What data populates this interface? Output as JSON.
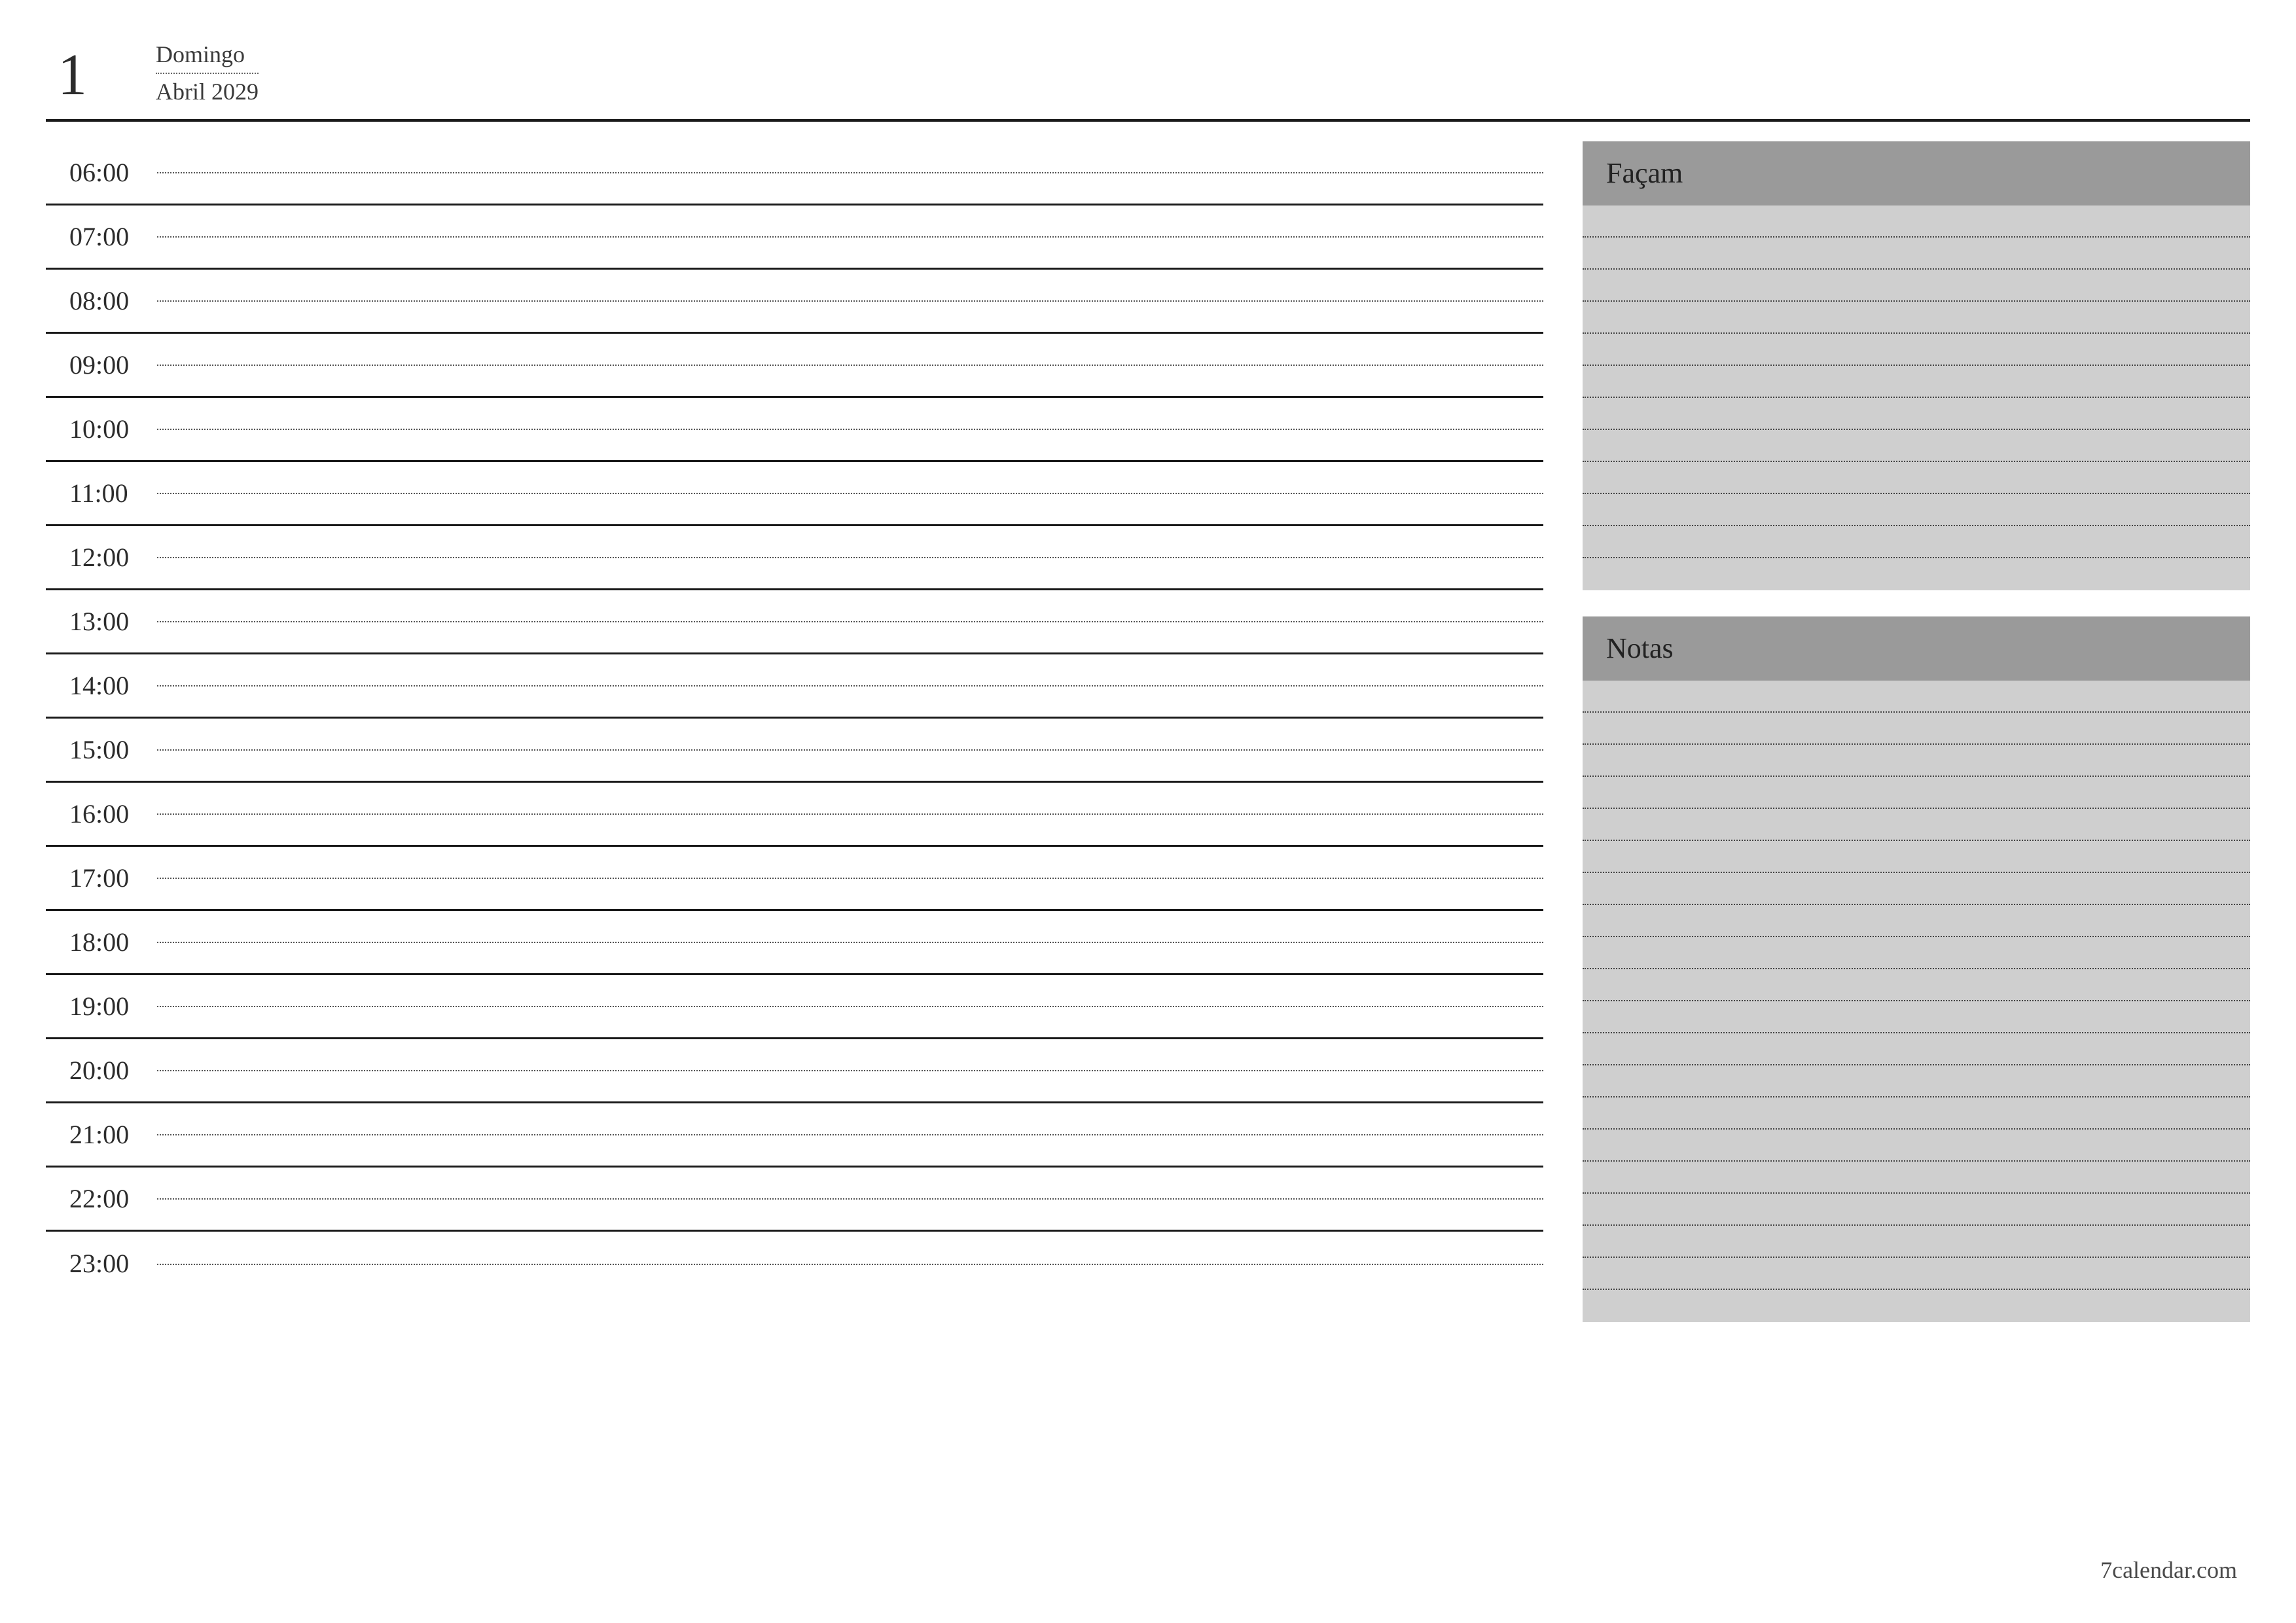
{
  "header": {
    "day_number": "1",
    "day_of_week": "Domingo",
    "month_year": "Abril 2029"
  },
  "schedule": {
    "hours": [
      "06:00",
      "07:00",
      "08:00",
      "09:00",
      "10:00",
      "11:00",
      "12:00",
      "13:00",
      "14:00",
      "15:00",
      "16:00",
      "17:00",
      "18:00",
      "19:00",
      "20:00",
      "21:00",
      "22:00",
      "23:00"
    ]
  },
  "side": {
    "todo_title": "Façam",
    "todo_lines": 12,
    "notes_title": "Notas",
    "notes_lines": 20
  },
  "footer": {
    "credit": "7calendar.com"
  }
}
